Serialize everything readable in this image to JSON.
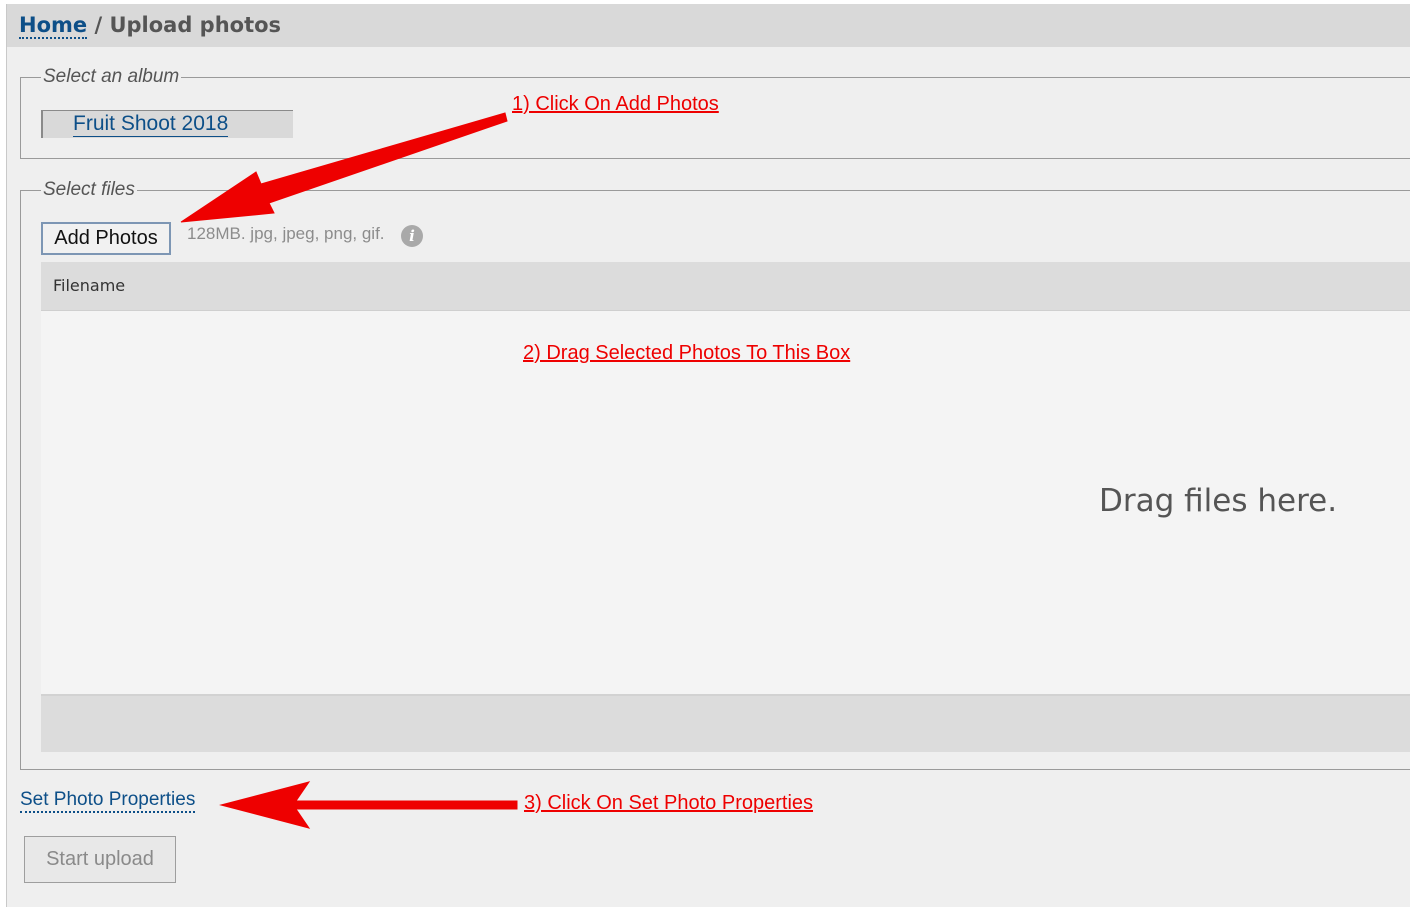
{
  "breadcrumb": {
    "home": "Home",
    "separator": "/",
    "current": "Upload photos"
  },
  "album_section": {
    "legend": "Select an album",
    "selected_album": "Fruit Shoot 2018"
  },
  "files_section": {
    "legend": "Select files",
    "add_button": "Add Photos",
    "hint": "128MB. jpg, jpeg, png, gif.",
    "info_icon": "i",
    "table_header": "Filename",
    "drop_text": "Drag files here."
  },
  "footer": {
    "set_properties": "Set Photo Properties",
    "start_upload": "Start upload"
  },
  "annotations": {
    "step1": "1) Click On Add Photos",
    "step2": "2) Drag Selected Photos To This Box",
    "step3": "3) Click On Set Photo Properties",
    "color": "#ee0000"
  },
  "colors": {
    "link": "#0d4f88",
    "header_bg": "#d9d9d9",
    "page_bg": "#efefef"
  }
}
